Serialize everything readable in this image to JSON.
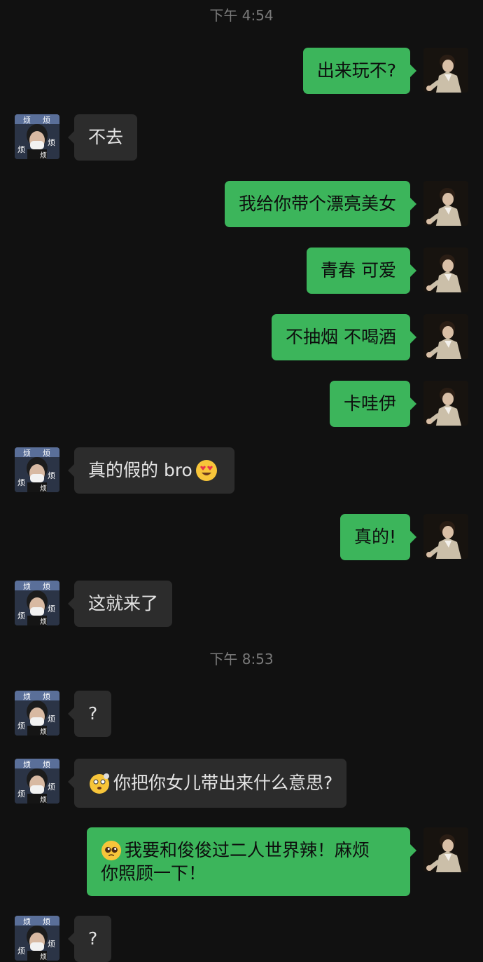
{
  "timestamps": [
    "下午 4:54",
    "下午 8:53"
  ],
  "messages": [
    {
      "side": "out",
      "text": "出来玩不?"
    },
    {
      "side": "in",
      "text": "不去"
    },
    {
      "side": "out",
      "text": "我给你带个漂亮美女"
    },
    {
      "side": "out",
      "text": "青春 可爱"
    },
    {
      "side": "out",
      "text": "不抽烟 不喝酒"
    },
    {
      "side": "out",
      "text": "卡哇伊"
    },
    {
      "side": "in",
      "text": "真的假的 bro",
      "emoji": "heart-eyes-emoji"
    },
    {
      "side": "out",
      "text": "真的!"
    },
    {
      "side": "in",
      "text": "这就来了"
    },
    {
      "side": "in",
      "text": "?"
    },
    {
      "side": "in",
      "text": "你把你女儿带出来什么意思?",
      "emoji": "dizzy-face-emoji"
    },
    {
      "side": "out",
      "text_line1": "我要和俊俊过二人世界辣！麻烦",
      "text_line2": "你照顾一下！",
      "emoji": "pleading-face-emoji"
    },
    {
      "side": "in",
      "text": "?"
    }
  ],
  "friend_avatar_text": [
    "烦",
    "烦",
    "烦",
    "烦"
  ],
  "colors": {
    "background": "#111111",
    "outgoing_bubble": "#3cb55b",
    "incoming_bubble": "#2c2c2c",
    "timestamp": "#7a7a7a"
  }
}
